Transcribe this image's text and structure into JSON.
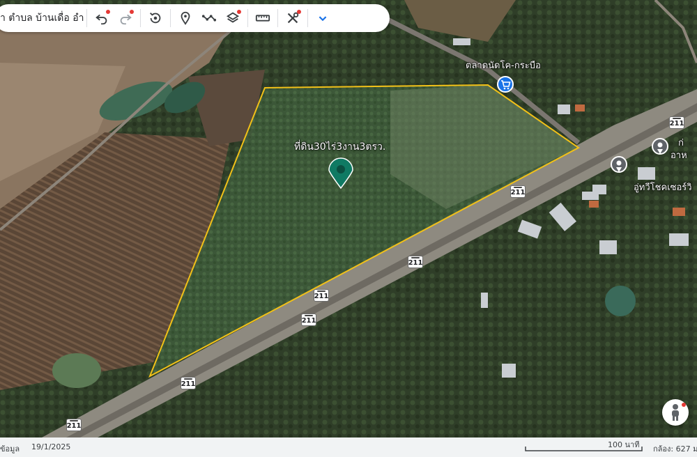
{
  "toolbar": {
    "search_text": "า ตำบล บ้านเดื่อ อำเ",
    "buttons": [
      {
        "name": "undo-icon",
        "badge": true
      },
      {
        "name": "redo-icon",
        "badge": true
      },
      {
        "name": "history-icon",
        "badge": false
      },
      {
        "name": "placemark-icon",
        "badge": false
      },
      {
        "name": "path-icon",
        "badge": false
      },
      {
        "name": "layers-icon",
        "badge": true
      },
      {
        "name": "measure-icon",
        "badge": false
      },
      {
        "name": "tools-icon",
        "badge": true
      },
      {
        "name": "expand-chevron-icon",
        "badge": false
      }
    ]
  },
  "map": {
    "polygon_label": "ที่ดิน30ไร่3งาน3ตรว.",
    "places": {
      "market": "ตลาดนัดโค-กระบือ",
      "garage": "อู่ทวีโชคเซอร์วิ",
      "partial_1": "ก่",
      "partial_2": "อาห"
    },
    "road_number": "211",
    "colors": {
      "polygon_outline": "#f2c118",
      "placemark": "#0f7a63",
      "shopping_pin": "#1a73e8",
      "place_pin": "#5f6368"
    }
  },
  "footer": {
    "data_label": "ข้อมูล",
    "date": "19/1/2025",
    "scale_label": "100 นาที",
    "camera_label": "กล้อง: 627 ม"
  }
}
